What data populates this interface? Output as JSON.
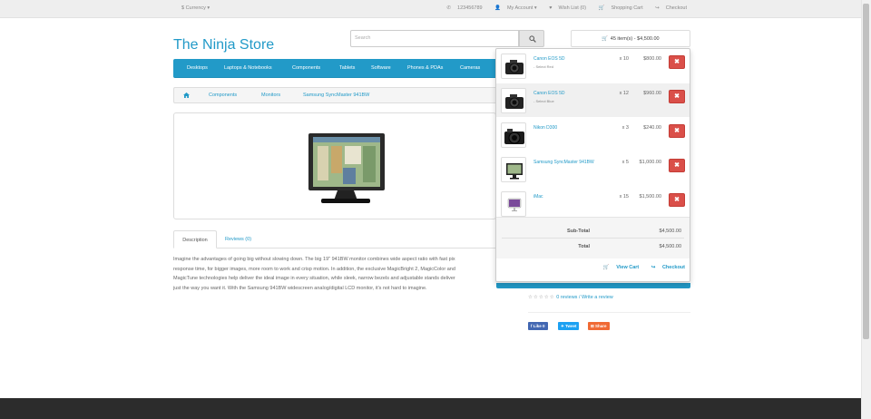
{
  "topbar": {
    "currency": "$ Currency",
    "phone": "123456789",
    "my_account": "My Account",
    "wishlist": "Wish List (0)",
    "shopping_cart": "Shopping Cart",
    "checkout": "Checkout"
  },
  "header": {
    "logo": "The Ninja Store",
    "search_placeholder": "Search",
    "cart_summary": "45 item(s) - $4,500.00"
  },
  "menu": [
    "Desktops",
    "Laptops & Notebooks",
    "Components",
    "Tablets",
    "Software",
    "Phones & PDAs",
    "Cameras"
  ],
  "breadcrumb": [
    "Components",
    "Monitors",
    "Samsung SyncMaster 941BW"
  ],
  "tabs": {
    "description": "Description",
    "reviews": "Reviews (0)"
  },
  "description": [
    "Imagine the advantages of going big without slowing down. The big 19\" 941BW monitor combines wide aspect ratio with fast pix",
    "response time, for bigger images, more room to work and crisp motion. In addition, the exclusive MagicBright 2, MagicColor and",
    "MagicTune technologies help deliver the ideal image in every situation, while sleek, narrow bezels and adjustable stands deliver",
    "just the way you want it. With the Samsung 941BW widescreen analog/digital LCD monitor, it's not hard to imagine."
  ],
  "reviews_line": {
    "count_link": "0 reviews",
    "separator": " / ",
    "write_link": "Write a review"
  },
  "share": {
    "like": "Like 0",
    "tweet": "Tweet",
    "share": "Share"
  },
  "cart": {
    "items": [
      {
        "name": "Canon EOS 5D",
        "option": "- Select Red",
        "qty": "x 10",
        "price": "$800.00",
        "icon": "camera-icon"
      },
      {
        "name": "Canon EOS 5D",
        "option": "- Select Blue",
        "qty": "x 12",
        "price": "$960.00",
        "icon": "camera-icon"
      },
      {
        "name": "Nikon D300",
        "option": "",
        "qty": "x 3",
        "price": "$240.00",
        "icon": "camera-icon"
      },
      {
        "name": "Samsung SyncMaster 941BW",
        "option": "",
        "qty": "x 5",
        "price": "$1,000.00",
        "icon": "monitor-icon"
      },
      {
        "name": "iMac",
        "option": "",
        "qty": "x 15",
        "price": "$1,500.00",
        "icon": "imac-icon"
      }
    ],
    "remove_glyph": "✖",
    "subtotal_label": "Sub-Total",
    "subtotal_value": "$4,500.00",
    "total_label": "Total",
    "total_value": "$4,500.00",
    "view_cart": "View Cart",
    "checkout": "Checkout"
  },
  "colors": {
    "accent": "#229ac8",
    "danger": "#da4f49",
    "footer": "#2c2c2c"
  }
}
